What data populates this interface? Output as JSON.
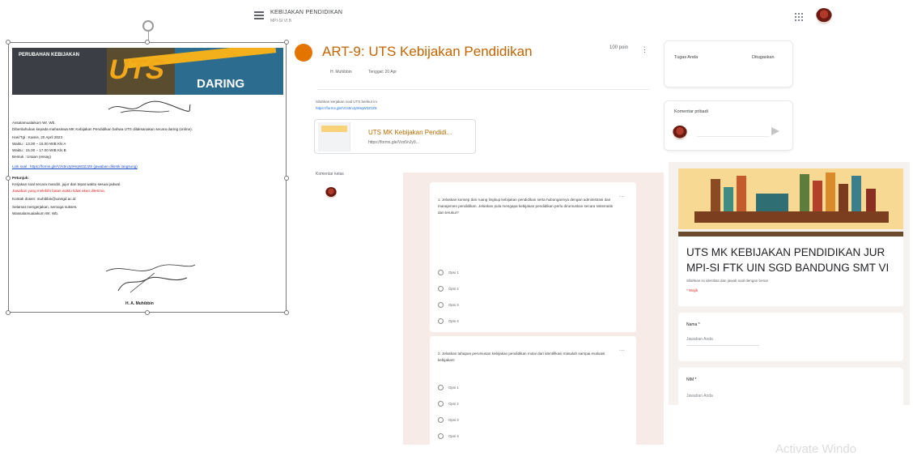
{
  "header": {
    "class_title": "KEBIJAKAN PENDIDIKAN",
    "class_subtitle": "MPI-SI VI B"
  },
  "assignment": {
    "title": "ART-9: UTS Kebijakan Pendidikan",
    "points": "100 poin",
    "author": "H. Muhibbin",
    "due": "Tenggat: 20 Apr",
    "description_line1": "Silahkan kerjakan soal UTS berikut ini",
    "description_line2": "https://forms.gle/Vzs5nJy9HqW3ZJZ6",
    "attachment_title": "UTS MK Kebijakan Pendidi...",
    "attachment_url": "https://forms.gle/Vzs5nJy9...",
    "class_comments_label": "Komentar kelas"
  },
  "sidebar": {
    "your_work_title": "Tugas Anda",
    "your_work_status": "Ditugaskan",
    "private_comments_title": "Komentar pribadi"
  },
  "form_questions": [
    {
      "text": "1. Jelaskan konsep dan ruang lingkup kebijakan pendidikan serta hubungannya dengan administrasi dan manajemen pendidikan. Jelaskan pula mengapa kebijakan pendidikan perlu dirumuskan secara sistematis dan terukur?",
      "options": [
        "Opsi 1",
        "Opsi 2",
        "Opsi 3",
        "Opsi 4"
      ]
    },
    {
      "text": "2. Jelaskan tahapan perumusan kebijakan pendidikan mulai dari identifikasi masalah sampai evaluasi kebijakan!",
      "options": [
        "Opsi 1",
        "Opsi 2",
        "Opsi 3",
        "Opsi 4"
      ]
    }
  ],
  "google_form": {
    "title": "UTS MK KEBIJAKAN PENDIDIKAN JUR MPI-SI FTK UIN SGD BANDUNG SMT VI",
    "description": "Silahkan isi identitas dan jawab soal dengan benar",
    "required_note": "* Wajib",
    "field1_label": "Nama *",
    "field1_placeholder": "Jawaban Anda",
    "field2_label": "NIM *",
    "field2_placeholder": "Jawaban Anda"
  },
  "document": {
    "banner_small": "PERUBAHAN KEBIJAKAN",
    "banner_big": "UTS",
    "banner_daring": "DARING",
    "lines": [
      "Assalamualaikum Wr. Wb.",
      "Diberitahukan kepada mahasiswa MK Kebijakan Pendidikan bahwa UTS dilaksanakan secara daring (online).",
      "Hari/Tgl : Kamis, 20 April 2023",
      "Waktu : 13.00 – 15.00 WIB Kls A",
      "Waktu : 15.00 – 17.00 WIB Kls B",
      "Bentuk : Uraian (essay)",
      "Link soal : https://forms.gle/Vzs5nJy9HqW3ZJZ6 (jawaban diketik langsung)",
      "Petunjuk:",
      "Kerjakan soal secara mandiri, jujur dan tepat waktu sesuai jadwal.",
      "Jawaban yang melebihi batas waktu tidak akan diterima.",
      "Kontak dosen: muhibbin@uinsgd.ac.id",
      "Selamat mengerjakan, semoga sukses.",
      "Wassalamualaikum Wr. Wb."
    ],
    "signature_name": "H. A. Muhibbin"
  },
  "watermark": "Activate Windo"
}
